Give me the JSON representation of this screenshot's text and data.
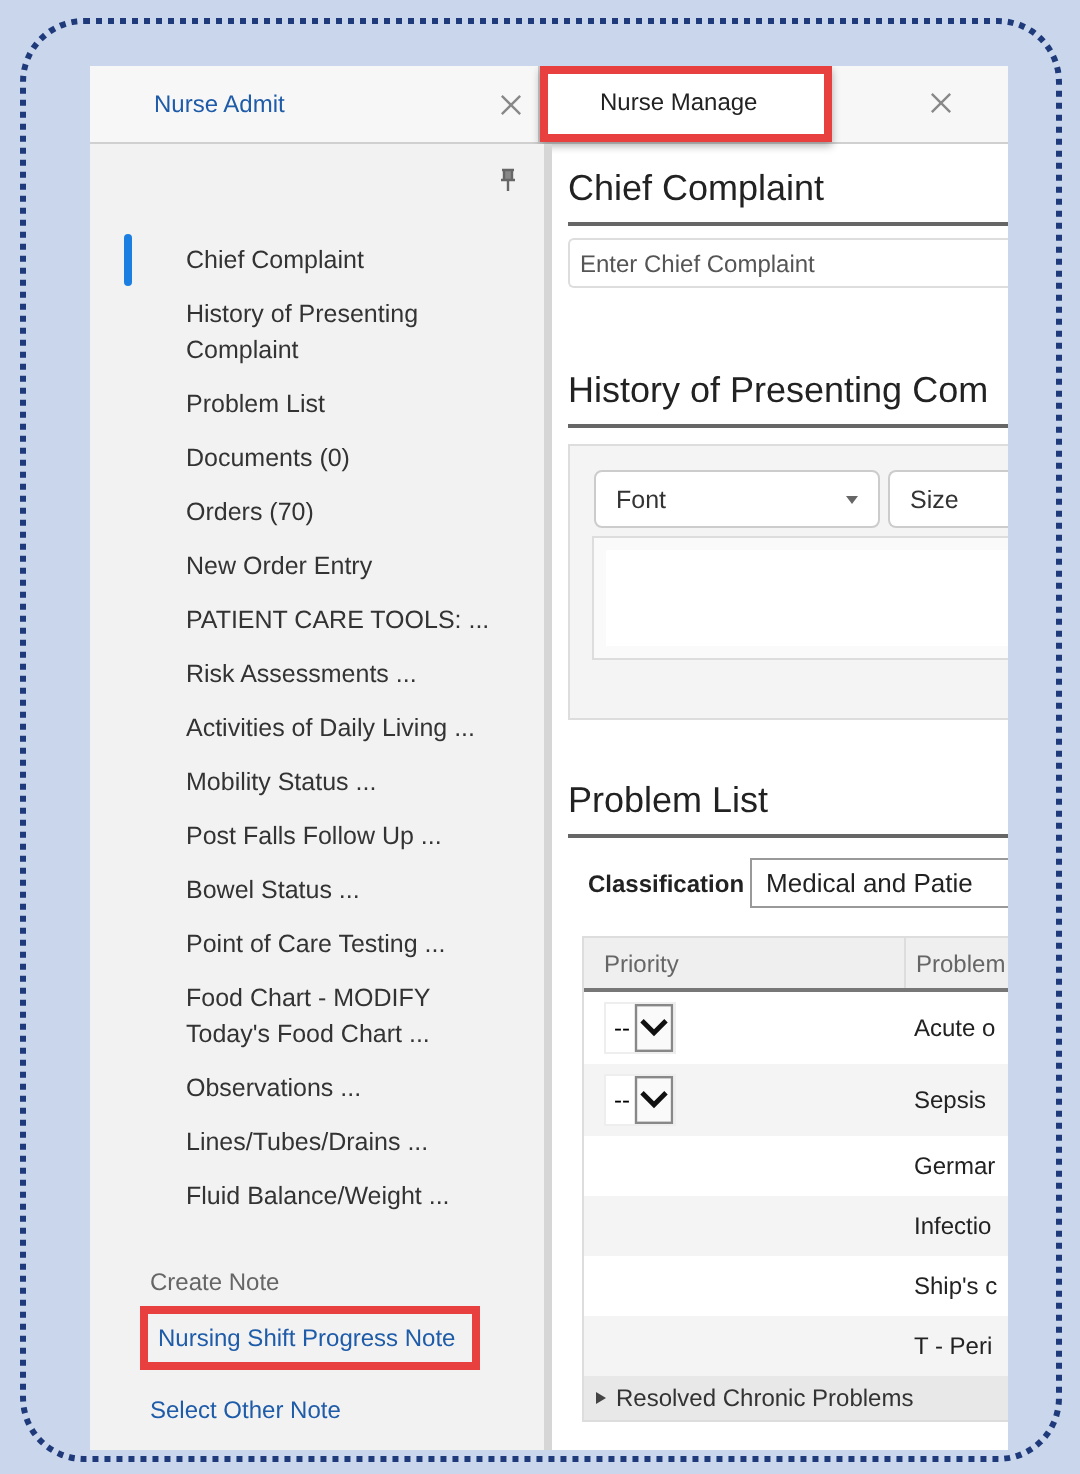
{
  "tabs": [
    {
      "label": "Nurse Admit",
      "selected": false,
      "highlighted": false
    },
    {
      "label": "Nurse Manage",
      "selected": true,
      "highlighted": true
    }
  ],
  "sidebar": {
    "items": [
      {
        "label": "Chief Complaint",
        "selected": true
      },
      {
        "label": "History of Presenting Complaint",
        "selected": false
      },
      {
        "label": "Problem List",
        "selected": false
      },
      {
        "label": "Documents (0)",
        "selected": false
      },
      {
        "label": "Orders (70)",
        "selected": false
      },
      {
        "label": "New Order Entry",
        "selected": false
      },
      {
        "label": "PATIENT CARE TOOLS: ...",
        "selected": false
      },
      {
        "label": "Risk Assessments ...",
        "selected": false
      },
      {
        "label": "Activities of Daily Living ...",
        "selected": false
      },
      {
        "label": "Mobility Status ...",
        "selected": false
      },
      {
        "label": "Post Falls Follow Up ...",
        "selected": false
      },
      {
        "label": "Bowel Status ...",
        "selected": false
      },
      {
        "label": "Point of Care Testing ...",
        "selected": false
      },
      {
        "label": "Food Chart - MODIFY Today's Food Chart ...",
        "selected": false
      },
      {
        "label": "Observations ...",
        "selected": false
      },
      {
        "label": "Lines/Tubes/Drains ...",
        "selected": false
      },
      {
        "label": "Fluid Balance/Weight ...",
        "selected": false
      }
    ],
    "create_note": {
      "title": "Create Note",
      "links": [
        {
          "label": "Nursing Shift Progress Note",
          "highlighted": true
        },
        {
          "label": "Select Other Note",
          "highlighted": false
        }
      ]
    }
  },
  "chief_complaint": {
    "title": "Chief Complaint",
    "placeholder": "Enter Chief Complaint"
  },
  "history": {
    "title": "History of Presenting Com",
    "font": "Font",
    "size": "Size"
  },
  "problem_list": {
    "title": "Problem List",
    "classification_label": "Classification",
    "classification_value": "Medical and Patie",
    "columns": [
      "Priority",
      "Problem"
    ],
    "rows": [
      {
        "kind": "dropdown",
        "priority": "--",
        "problem": "Acute o"
      },
      {
        "kind": "dropdown",
        "priority": "--",
        "problem": "Sepsis"
      },
      {
        "kind": "plain",
        "problem": "Germar"
      },
      {
        "kind": "plain",
        "problem": "Infectio"
      },
      {
        "kind": "plain",
        "problem": "Ship's c"
      },
      {
        "kind": "plain",
        "problem": "T - Peri"
      }
    ],
    "group": "Resolved Chronic Problems"
  }
}
